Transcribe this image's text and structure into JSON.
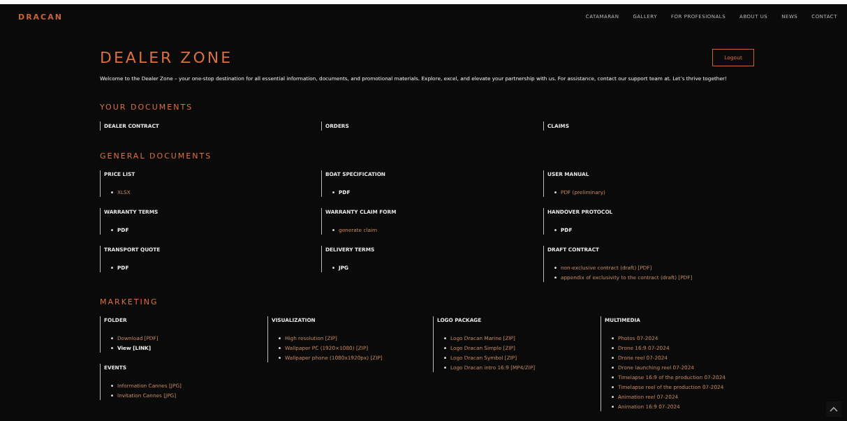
{
  "header": {
    "logo": "DRACAN",
    "nav": [
      {
        "label": "CATAMARAN"
      },
      {
        "label": "GALLERY"
      },
      {
        "label": "FOR PROFESIONALS"
      },
      {
        "label": "ABOUT US"
      },
      {
        "label": "NEWS"
      },
      {
        "label": "CONTACT"
      }
    ]
  },
  "title": "DEALER ZONE",
  "logout_button": "Logout",
  "welcome": "Welcome to the Dealer Zone – your one-stop destination for all essential information, documents, and promotional materials. Explore, excel, and elevate your partnership with us. For assistance, contact our support team at. Let’s thrive together!",
  "your_documents": {
    "heading": "YOUR DOCUMENTS",
    "items": [
      "DEALER CONTRACT",
      "ORDERS",
      "CLAIMS"
    ]
  },
  "general_documents": {
    "heading": "GENERAL DOCUMENTS",
    "blocks": [
      {
        "title": "PRICE LIST",
        "items": [
          {
            "text": "XLSX",
            "kind": "link"
          }
        ]
      },
      {
        "title": "BOAT SPECIFICATION",
        "items": [
          {
            "text": "PDF",
            "kind": "plain"
          }
        ]
      },
      {
        "title": "USER MANUAL",
        "items": [
          {
            "text": "PDF (preliminary)",
            "kind": "link"
          }
        ]
      },
      {
        "title": "WARRANTY TERMS",
        "items": [
          {
            "text": "PDF",
            "kind": "plain"
          }
        ]
      },
      {
        "title": "WARRANTY CLAIM FORM",
        "items": [
          {
            "text": "generate claim",
            "kind": "link"
          }
        ]
      },
      {
        "title": "HANDOVER PROTOCOL",
        "items": [
          {
            "text": "PDF",
            "kind": "plain"
          }
        ]
      },
      {
        "title": "TRANSPORT QUOTE",
        "items": [
          {
            "text": "PDF",
            "kind": "plain"
          }
        ]
      },
      {
        "title": "DELIVERY TERMS",
        "items": [
          {
            "text": "JPG",
            "kind": "plain"
          }
        ]
      },
      {
        "title": "DRAFT CONTRACT",
        "items": [
          {
            "text": "non-exclusive contract (draft) [PDF]",
            "kind": "link"
          },
          {
            "text": "appendix of exclusivity to the contract (draft) [PDF]",
            "kind": "link"
          }
        ]
      }
    ]
  },
  "marketing": {
    "heading": "MARKETING",
    "columns": [
      {
        "blocks": [
          {
            "title": "FOLDER",
            "items": [
              {
                "text": "Download [PDF]",
                "kind": "link"
              },
              {
                "text": "View [LINK]",
                "kind": "plain"
              }
            ]
          },
          {
            "title": "EVENTS",
            "items": [
              {
                "text": "Information Cannes [JPG]",
                "kind": "link"
              },
              {
                "text": "Invitation Cannes [JPG]",
                "kind": "link"
              }
            ]
          }
        ]
      },
      {
        "blocks": [
          {
            "title": "VISUALIZATION",
            "items": [
              {
                "text": "High resolution [ZIP]",
                "kind": "link"
              },
              {
                "text": "Wallpaper PC (1920×1080) [ZIP]",
                "kind": "link"
              },
              {
                "text": "Wallpaper phone (1080x1920px) [ZIP]",
                "kind": "link"
              }
            ]
          }
        ]
      },
      {
        "blocks": [
          {
            "title": "LOGO PACKAGE",
            "items": [
              {
                "text": "Logo Dracan Marine [ZIP]",
                "kind": "link"
              },
              {
                "text": "Logo Dracan Simple [ZIP]",
                "kind": "link"
              },
              {
                "text": "Logo Dracan Symbol [ZIP]",
                "kind": "link"
              },
              {
                "text": "Logo Dracan intro 16:9 [MP4/ZIP]",
                "kind": "link"
              }
            ]
          }
        ]
      },
      {
        "blocks": [
          {
            "title": "MULTIMEDIA",
            "items": [
              {
                "text": "Photos 07-2024",
                "kind": "link"
              },
              {
                "text": "Drone 16:9 07-2024",
                "kind": "link"
              },
              {
                "text": "Drone reel 07-2024",
                "kind": "link"
              },
              {
                "text": "Drone launching reel 07-2024",
                "kind": "link"
              },
              {
                "text": "Timelapse 16:9 of the production 07-2024",
                "kind": "link"
              },
              {
                "text": "Timelapse reel of the production 07-2024",
                "kind": "link"
              },
              {
                "text": "Animation reel 07-2024",
                "kind": "link"
              },
              {
                "text": "Animation 16:9 07-2024",
                "kind": "link"
              }
            ]
          }
        ]
      }
    ]
  }
}
